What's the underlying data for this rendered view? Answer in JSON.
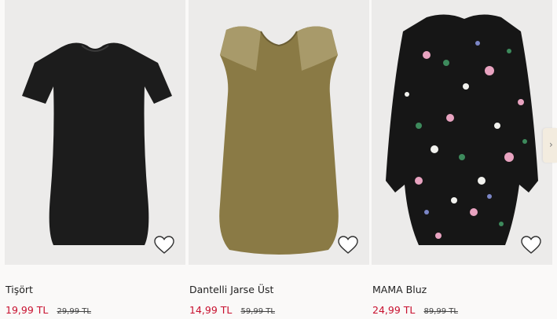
{
  "products": [
    {
      "name": "Tişört",
      "price": "19,99 TL",
      "old_price": "29,99 TL",
      "image": "black-tshirt",
      "favorite_icon": "heart-outline-icon"
    },
    {
      "name": "Dantelli Jarse Üst",
      "price": "14,99 TL",
      "old_price": "59,99 TL",
      "image": "olive-lace-top",
      "favorite_icon": "heart-outline-icon"
    },
    {
      "name": "MAMA Bluz",
      "price": "24,99 TL",
      "old_price": "89,99 TL",
      "image": "floral-blouse",
      "favorite_icon": "heart-outline-icon"
    }
  ],
  "carousel": {
    "next_icon": "chevron-right-icon"
  },
  "colors": {
    "sale_price": "#c8102e",
    "background": "#faf9f8",
    "image_bg": "#ecebea"
  }
}
